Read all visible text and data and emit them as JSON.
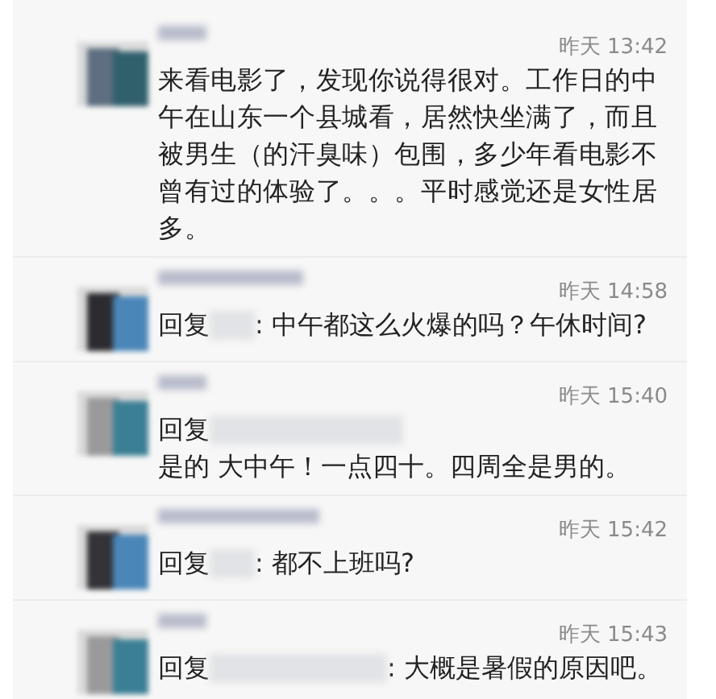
{
  "comments": [
    {
      "kind": "post",
      "time": "昨天 13:42",
      "text": "来看电影了，发现你说得很对。工作日的中午在山东一个县城看，居然快坐满了，而且被男生（的汗臭味）包围，多少年看电影不曾有过的体验了。。。平时感觉还是女性居多。"
    },
    {
      "kind": "reply",
      "time": "昨天 14:58",
      "prefix": "回复",
      "text": ": 中午都这么火爆的吗？午休时间?"
    },
    {
      "kind": "reply",
      "time": "昨天 15:40",
      "prefix": "回复",
      "text": "是的 大中午！一点四十。四周全是男的。"
    },
    {
      "kind": "reply",
      "time": "昨天 15:42",
      "prefix": "回复",
      "text": ": 都不上班吗?"
    },
    {
      "kind": "reply",
      "time": "昨天 15:43",
      "prefix": "回复",
      "text": ": 大概是暑假的原因吧。"
    }
  ]
}
